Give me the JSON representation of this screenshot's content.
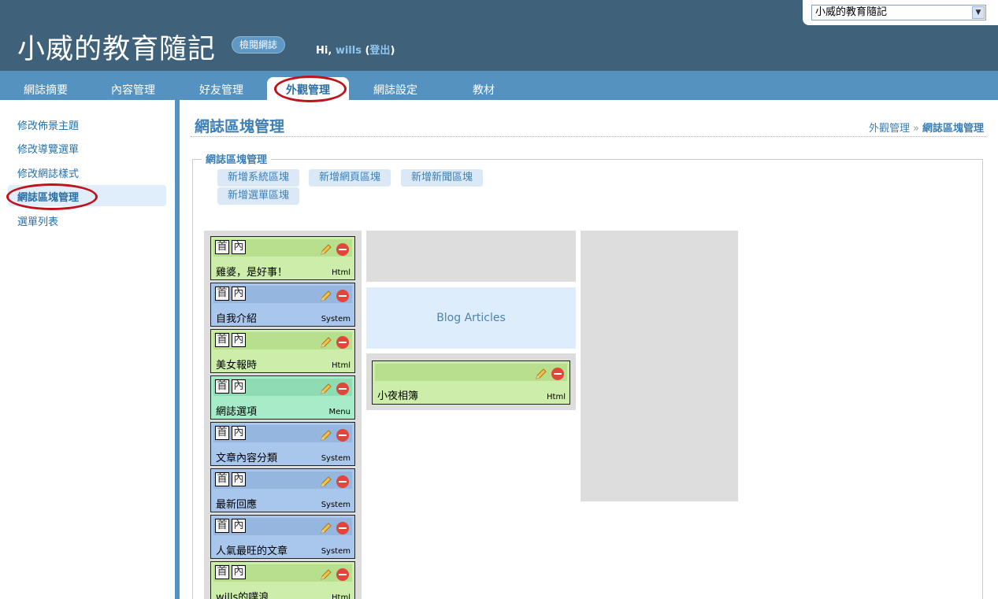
{
  "header": {
    "site_title": "小威的教育隨記",
    "view_blog_label": "檢閱網誌",
    "greeting_prefix": "Hi,",
    "username": "wills",
    "logout_label": "登出",
    "open_paren": "(",
    "close_paren": ")",
    "blog_selector_value": "小威的教育隨記"
  },
  "nav": {
    "tabs": [
      {
        "label": "網誌摘要"
      },
      {
        "label": "內容管理"
      },
      {
        "label": "好友管理"
      },
      {
        "label": "外觀管理",
        "active": true
      },
      {
        "label": "網誌設定"
      },
      {
        "label": "教材"
      }
    ]
  },
  "sidebar": {
    "items": [
      {
        "label": "修改佈景主題"
      },
      {
        "label": "修改導覽選單"
      },
      {
        "label": "修改網誌樣式"
      },
      {
        "label": "網誌區塊管理",
        "active": true
      },
      {
        "label": "選單列表"
      }
    ]
  },
  "main": {
    "page_title": "網誌區塊管理",
    "breadcrumb": {
      "parent": "外觀管理",
      "separator": "»",
      "current": "網誌區塊管理"
    },
    "legend": "網誌區塊管理",
    "add_buttons": [
      "新增系統區塊",
      "新增網頁區塊",
      "新增新聞區塊",
      "新增選單區塊"
    ],
    "tag_home": "首",
    "tag_inner": "內",
    "left_widgets": [
      {
        "name": "雞婆，是好事！",
        "type": "Html",
        "color": "green"
      },
      {
        "name": "自我介紹",
        "type": "System",
        "color": "blue"
      },
      {
        "name": "美女報時",
        "type": "Html",
        "color": "green"
      },
      {
        "name": "網誌選項",
        "type": "Menu",
        "color": "teal"
      },
      {
        "name": "文章內容分類",
        "type": "System",
        "color": "blue"
      },
      {
        "name": "最新回應",
        "type": "System",
        "color": "blue"
      },
      {
        "name": "人氣最旺的文章",
        "type": "System",
        "color": "blue"
      },
      {
        "name": "wills的噗浪",
        "type": "Html",
        "color": "green"
      }
    ],
    "blog_articles_label": "Blog Articles",
    "center_widget": {
      "name": "小夜相簿",
      "type": "Html",
      "color": "green"
    }
  },
  "colors": {
    "header_bg": "#3f627a",
    "nav_bg": "#5692c0",
    "accent": "#3d7fb5",
    "highlight_oval": "#c0141b"
  },
  "icons": {
    "edit": "pencil-icon",
    "delete": "delete-icon",
    "select_arrow": "chevron-down-icon"
  }
}
